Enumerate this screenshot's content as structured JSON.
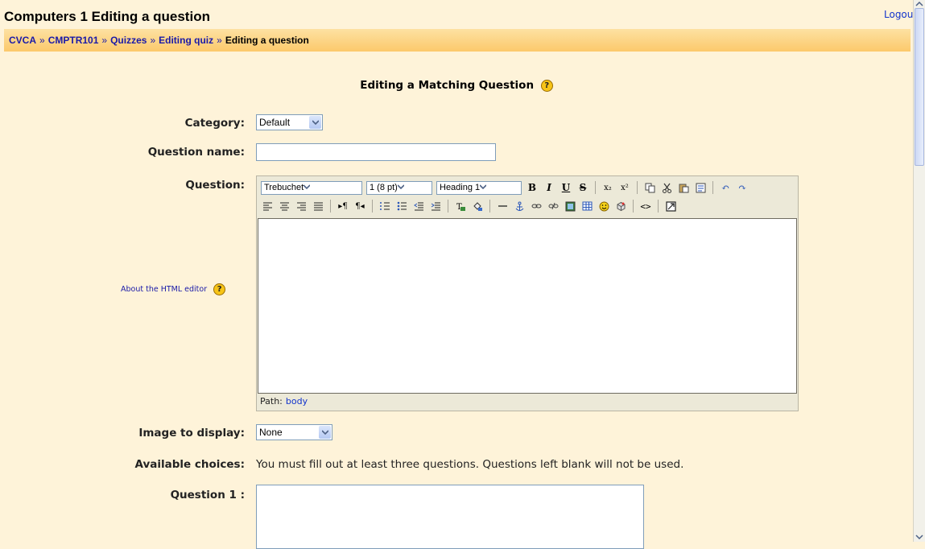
{
  "header": {
    "title": "Computers 1 Editing a question",
    "logout": "Logout"
  },
  "breadcrumb": {
    "items": [
      "CVCA",
      "CMPTR101",
      "Quizzes",
      "Editing quiz"
    ],
    "separator": "»",
    "current": "Editing a question"
  },
  "form": {
    "heading": "Editing a Matching Question",
    "help_glyph": "?",
    "category": {
      "label": "Category:",
      "value": "Default"
    },
    "question_name": {
      "label": "Question name:",
      "value": ""
    },
    "question": {
      "label": "Question:"
    },
    "about_editor": "About the HTML editor",
    "image": {
      "label": "Image to display:",
      "value": "None"
    },
    "choices": {
      "label": "Available choices:",
      "text": "You must fill out at least three questions. Questions left blank will not be used."
    },
    "question1": {
      "label": "Question 1 :"
    }
  },
  "editor": {
    "font": "Trebuchet",
    "size": "1 (8 pt)",
    "format": "Heading 1",
    "path_label": "Path:",
    "path_value": "body"
  },
  "colors": {
    "background": "#fef3d9",
    "navbar": "#fcc96b",
    "link": "#1a1aa8"
  }
}
